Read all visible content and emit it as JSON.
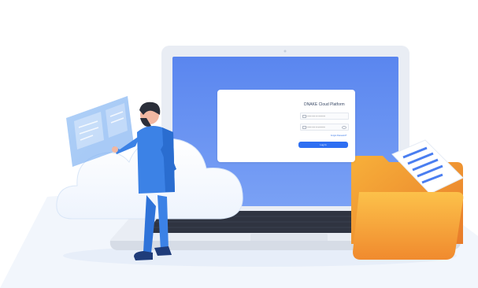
{
  "login": {
    "title": "DNAKE Cloud Platform",
    "username_placeholder": "Please enter the username",
    "password_placeholder": "Please enter the password",
    "forgot_label": "Forgot Password?",
    "login_label": "Log In"
  },
  "colors": {
    "screen_blue": "#5e8cf0",
    "laptop_frame": "#e9edf4",
    "accent_blue": "#2e6ff2",
    "folder_orange": "#f5a623",
    "cloud_white": "#ffffff"
  },
  "icons": [
    "person-figure",
    "holographic-panel",
    "cloud-shape",
    "laptop",
    "keyboard",
    "folder-icon",
    "document-icon",
    "user-icon",
    "lock-icon",
    "eye-icon"
  ]
}
